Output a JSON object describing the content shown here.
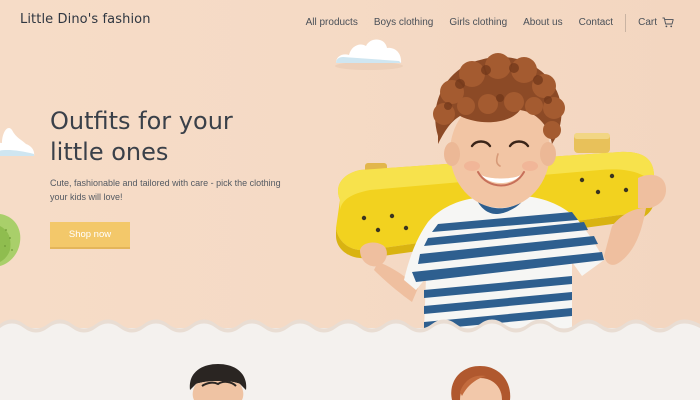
{
  "nav": {
    "brand": "Little Dino's fashion",
    "links": [
      "All products",
      "Boys clothing",
      "Girls clothing",
      "About us",
      "Contact"
    ],
    "cart_label": "Cart"
  },
  "hero": {
    "headline_line1": "Outfits for your",
    "headline_line2": "little ones",
    "subtext": "Cute, fashionable and tailored with care - pick the clothing your kids will love!",
    "cta_label": "Shop now"
  },
  "colors": {
    "hero_bg": "#f5dac5",
    "cta": "#f3c86a",
    "lower_bg": "#f4f1ee",
    "text": "#3a4049"
  },
  "icons": {
    "cart": "shopping-cart-icon"
  }
}
